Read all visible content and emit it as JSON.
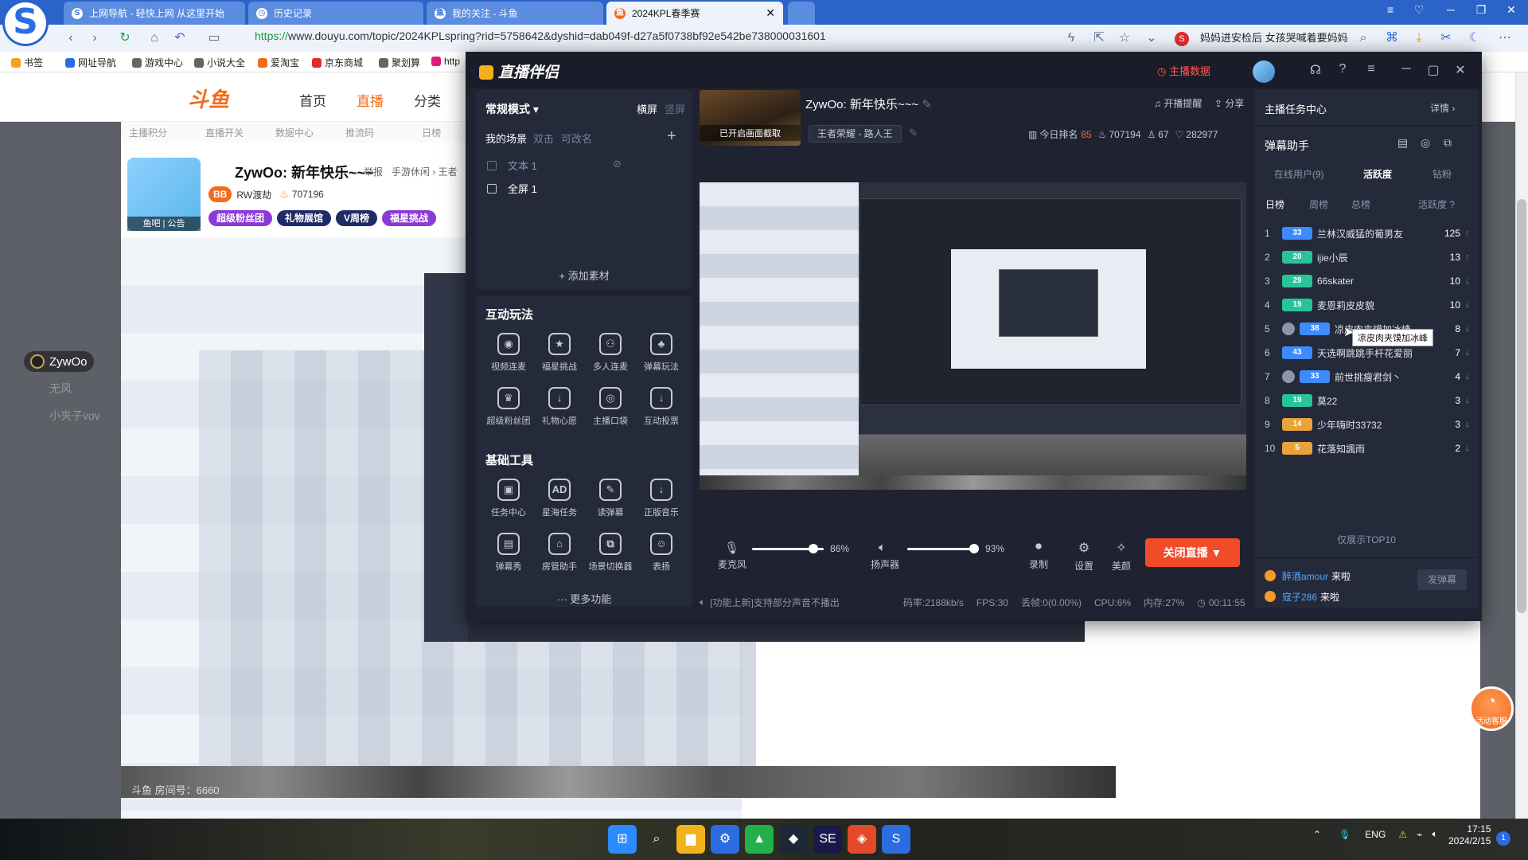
{
  "browser": {
    "logo_glyph": "S",
    "tabs": [
      {
        "label": "上网导航 - 轻快上网 从这里开始",
        "active": false
      },
      {
        "label": "历史记录",
        "active": false
      },
      {
        "label": "我的关注 - 斗鱼",
        "active": false
      },
      {
        "label": "2024KPL春季赛",
        "active": true
      }
    ],
    "url_https": "https://",
    "url_rest": "www.douyu.com/topic/2024KPLspring?rid=5758642&dyshid=dab049f-d27a5f0738bf92e542be738000031601",
    "ad_text": "妈妈进安检后 女孩哭喊着要妈妈",
    "bookmarks": [
      "书签",
      "网址导航",
      "游戏中心",
      "小说大全",
      "爱淘宝",
      "京东商城",
      "聚划算",
      "http"
    ]
  },
  "douyu": {
    "logo": "斗鱼",
    "nav": [
      "首页",
      "直播",
      "分类"
    ],
    "strip_items": [
      "主播积分",
      "直播开关",
      "数据中心",
      "推流码",
      "日榜"
    ],
    "streamer_title": "ZywOo: 新年快乐~~~",
    "report": "举报",
    "category": "手游休闲 › 王者",
    "viewers": "707196",
    "badge_bb": "BB",
    "badge_team": "RW渡劫",
    "badges": [
      "超级粉丝团",
      "礼物展馆",
      "V周榜",
      "福星挑战"
    ],
    "side_name": "ZywOo",
    "side_names_faded": [
      "无风",
      "小夹子vov"
    ],
    "room_label": "斗鱼 房间号：6660",
    "service_label": "活动客服",
    "avatar_caption": "鱼吧 | 公告"
  },
  "zbpl": {
    "app_name": "直播伴侣",
    "anchor_data": "主播数据",
    "mode": "常规模式",
    "orient_h": "横屏",
    "orient_v": "竖屏",
    "scene_tabs": [
      "我的场景",
      "双击",
      "可改名"
    ],
    "sources": [
      "文本 1",
      "全屏 1"
    ],
    "add_material": "+ 添加素材",
    "interactive_title": "互动玩法",
    "interactive_tools": [
      {
        "label": "视频连麦",
        "icon": "mic-link-icon",
        "glyph": "◉"
      },
      {
        "label": "福星挑战",
        "icon": "shield-star-icon",
        "glyph": "★"
      },
      {
        "label": "多人连麦",
        "icon": "multi-mic-icon",
        "glyph": "⚇"
      },
      {
        "label": "弹幕玩法",
        "icon": "danmu-game-icon",
        "glyph": "♣"
      },
      {
        "label": "超级粉丝团",
        "icon": "fan-club-icon",
        "glyph": "♛"
      },
      {
        "label": "礼物心愿",
        "icon": "gift-wish-icon",
        "glyph": "↓"
      },
      {
        "label": "主播口袋",
        "icon": "pocket-icon",
        "glyph": "◎"
      },
      {
        "label": "互动投票",
        "icon": "vote-icon",
        "glyph": "↓"
      }
    ],
    "basic_title": "基础工具",
    "basic_tools": [
      {
        "label": "任务中心",
        "icon": "task-icon",
        "glyph": "▣"
      },
      {
        "label": "星海任务",
        "icon": "ad-task-icon",
        "glyph": "AD"
      },
      {
        "label": "读弹幕",
        "icon": "read-danmu-icon",
        "glyph": "✎"
      },
      {
        "label": "正版音乐",
        "icon": "music-icon",
        "glyph": "↓"
      },
      {
        "label": "弹幕秀",
        "icon": "danmu-show-icon",
        "glyph": "▤"
      },
      {
        "label": "房管助手",
        "icon": "room-manager-icon",
        "glyph": "⌂"
      },
      {
        "label": "场景切换器",
        "icon": "scene-switch-icon",
        "glyph": "⧉"
      },
      {
        "label": "表扬",
        "icon": "smile-icon",
        "glyph": "☺"
      }
    ],
    "more": "··· 更多功能",
    "thumb_label": "已开启画面截取",
    "room_title": "ZywOo: 新年快乐~~~",
    "category": "王者荣耀 - 路人王",
    "open_remind": "开播提醒",
    "share": "分享",
    "today_rank_label": "今日排名",
    "today_rank": "85",
    "hot": "707194",
    "users": "67",
    "likes": "282977",
    "mic_label": "麦克风",
    "mic_pct": "86%",
    "mic_level": 0.86,
    "speaker_label": "扬声器",
    "speaker_pct": "93%",
    "speaker_level": 0.93,
    "record": "录制",
    "settings": "设置",
    "beauty": "美颜",
    "stop_live": "关闭直播 ▼",
    "status_notice": "[功能上新]支持部分声音不播出",
    "bitrate": "码率:2188kb/s",
    "fps": "FPS:30",
    "drop": "丢帧:0(0.00%)",
    "cpu": "CPU:6%",
    "mem": "内存:27%",
    "time": "00:11:55",
    "task_center": "主播任务中心",
    "task_detail": "详情 ›",
    "danmu_helper": "弹幕助手",
    "rp_tabs": [
      "在线用户(9)",
      "活跃度",
      "钻粉"
    ],
    "rank_tabs": [
      "日榜",
      "周榜",
      "总榜",
      "活跃度 ?"
    ],
    "ranks": [
      {
        "n": "1",
        "lvl": "33",
        "color": "#3d8bff",
        "name": "兰林汉威猛的葡男友",
        "score": "125",
        "dir": "up"
      },
      {
        "n": "2",
        "lvl": "20",
        "color": "#27c49a",
        "name": "ijie小辰",
        "score": "13",
        "dir": "up"
      },
      {
        "n": "3",
        "lvl": "29",
        "color": "#27c49a",
        "name": "66skater",
        "score": "10",
        "dir": "down"
      },
      {
        "n": "4",
        "lvl": "19",
        "color": "#27c49a",
        "name": "麦恩莉皮皮貌",
        "score": "10",
        "dir": "down"
      },
      {
        "n": "5",
        "lvl": "38",
        "color": "#3d8bff",
        "name": "凉皮肉夹馍加冰峰",
        "score": "8",
        "dir": "down",
        "crown": true
      },
      {
        "n": "6",
        "lvl": "43",
        "color": "#3d8bff",
        "name": "天选啊跳跳手杆花爱丽",
        "score": "7",
        "dir": "down"
      },
      {
        "n": "7",
        "lvl": "33",
        "color": "#3d8bff",
        "name": "前世挑瘦君剑丶",
        "score": "4",
        "dir": "down",
        "crown": true
      },
      {
        "n": "8",
        "lvl": "19",
        "color": "#27c49a",
        "name": "莫22",
        "score": "3",
        "dir": "down"
      },
      {
        "n": "9",
        "lvl": "14",
        "color": "#e8a33a",
        "name": "少年嗨时33732",
        "score": "3",
        "dir": "down"
      },
      {
        "n": "10",
        "lvl": "5",
        "color": "#e8a33a",
        "name": "花落知諷雨",
        "score": "2",
        "dir": "down"
      }
    ],
    "tooltip": "凉皮肉夹馍加冰峰",
    "top10": "仅展示TOP10",
    "chat": [
      {
        "name": "醉酒amour",
        "text": "来啦"
      },
      {
        "name": "寇子286",
        "text": "来啦"
      }
    ],
    "send_danmu": "发弹幕"
  },
  "taskbar": {
    "apps": [
      "⊞",
      "⌕",
      "▆",
      "⚙",
      "▲",
      "◆",
      "SE",
      "◈",
      "S"
    ],
    "ime": "ENG",
    "time": "17:15",
    "date": "2024/2/15"
  }
}
